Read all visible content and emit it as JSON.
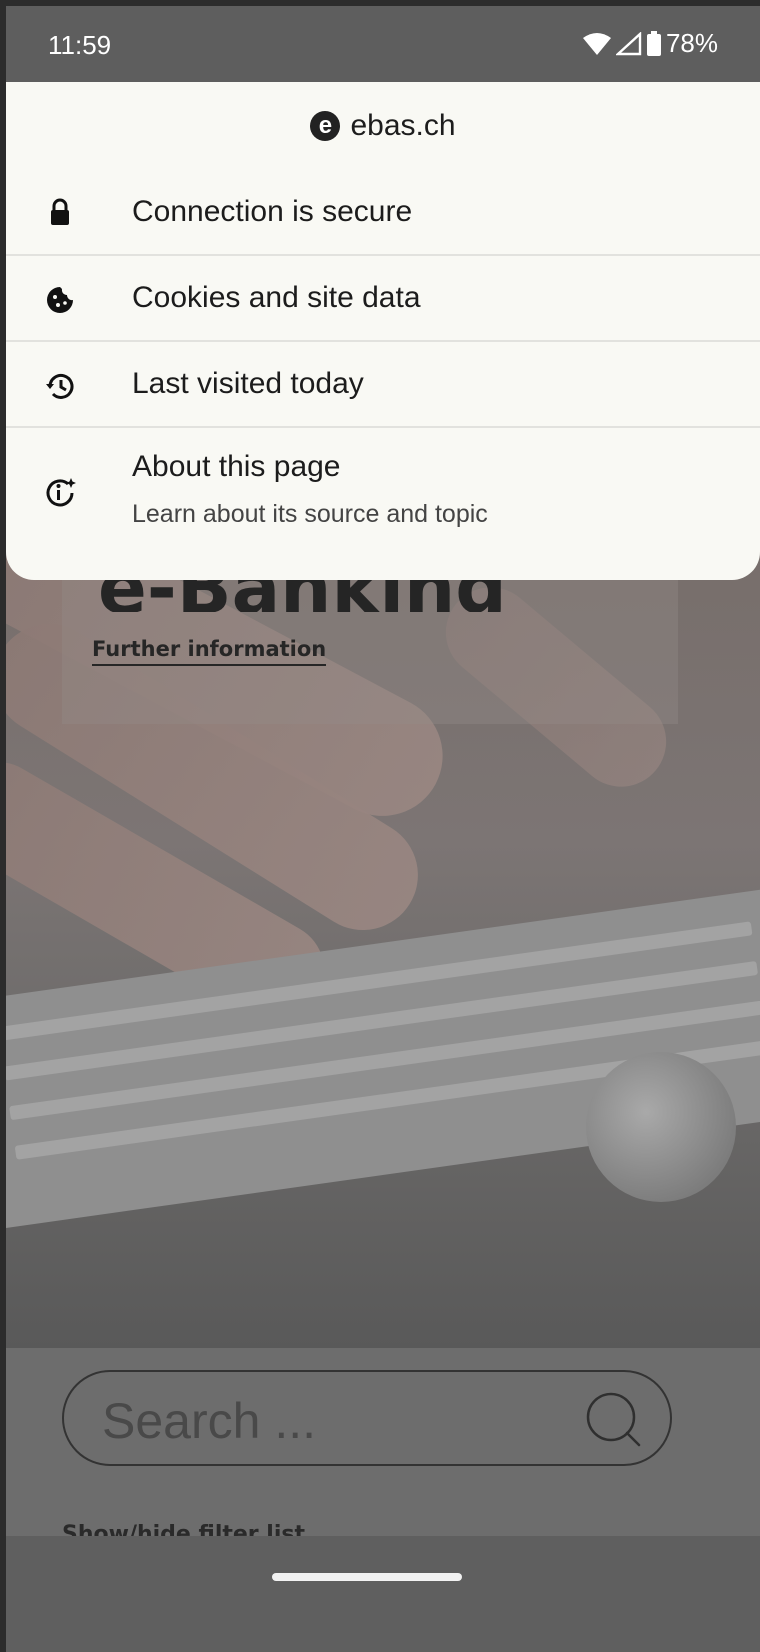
{
  "status_bar": {
    "time": "11:59",
    "battery": "78%"
  },
  "site_info": {
    "site_name": "ebas.ch",
    "items": [
      {
        "label": "Connection is secure",
        "icon": "lock-icon"
      },
      {
        "label": "Cookies and site data",
        "icon": "cookie-icon"
      },
      {
        "label": "Last visited today",
        "icon": "history-icon"
      },
      {
        "label": "About this page",
        "sublabel": "Learn about its source and topic",
        "icon": "info-sparkle-icon"
      }
    ]
  },
  "page": {
    "further_information": "Further information",
    "hero_heading": "e-Banking",
    "search_placeholder": "Search ...",
    "filter_toggle": "Show/hide filter list"
  }
}
